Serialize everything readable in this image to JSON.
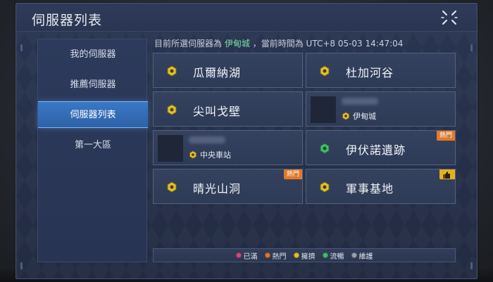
{
  "window": {
    "title": "伺服器列表"
  },
  "sidebar": {
    "items": [
      {
        "label": "我的伺服器",
        "active": false
      },
      {
        "label": "推薦伺服器",
        "active": false
      },
      {
        "label": "伺服器列表",
        "active": true
      },
      {
        "label": "第一大區",
        "active": false
      }
    ]
  },
  "status": {
    "prefix": "目前所選伺服器為",
    "current_server": "伊甸城",
    "middle": "，當前時間為",
    "time": "UTC+8 05-03 14:47:04"
  },
  "servers": [
    {
      "name": "瓜爾納湖",
      "state": "crowded",
      "badge": null
    },
    {
      "name": "杜加河谷",
      "state": "crowded",
      "badge": null
    },
    {
      "name": "尖叫戈壁",
      "state": "crowded",
      "badge": null
    },
    {
      "name": "伊甸城",
      "state": "crowded",
      "badge": null,
      "has_character": true
    },
    {
      "name": "中央車站",
      "state": "crowded",
      "badge": null,
      "has_character": true
    },
    {
      "name": "伊伏諾遺跡",
      "state": "smooth",
      "badge": "熱門"
    },
    {
      "name": "晴光山洞",
      "state": "crowded",
      "badge": "熱門"
    },
    {
      "name": "軍事基地",
      "state": "crowded",
      "badge": "like"
    }
  ],
  "legend": [
    {
      "label": "已滿",
      "color": "#d8487e"
    },
    {
      "label": "熱門",
      "color": "#e0762a"
    },
    {
      "label": "擁擠",
      "color": "#e2c02a"
    },
    {
      "label": "流暢",
      "color": "#3fbf6a"
    },
    {
      "label": "維護",
      "color": "#9aa0ab"
    }
  ],
  "colors": {
    "crowded": "#e2c02a",
    "smooth": "#3fbf6a",
    "accent": "#3a78c4"
  },
  "icons": {
    "close": "close-icon",
    "server_status": "hex-status-icon",
    "like": "thumbs-up-icon"
  }
}
